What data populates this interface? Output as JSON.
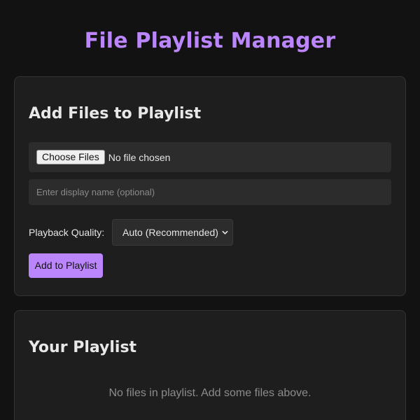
{
  "app": {
    "title": "File Playlist Manager"
  },
  "add_section": {
    "heading": "Add Files to Playlist",
    "file_input": {
      "button_label": "Choose Files",
      "status": "No file chosen"
    },
    "display_name_input": {
      "value": "",
      "placeholder": "Enter display name (optional)"
    },
    "quality": {
      "label": "Playback Quality:",
      "selected": "Auto (Recommended)"
    },
    "add_button_label": "Add to Playlist"
  },
  "playlist_section": {
    "heading": "Your Playlist",
    "empty_message": "No files in playlist. Add some files above."
  },
  "colors": {
    "accent": "#bb86fc",
    "background": "#121212",
    "card": "#1e1e1e",
    "input": "#2c2c2c"
  }
}
